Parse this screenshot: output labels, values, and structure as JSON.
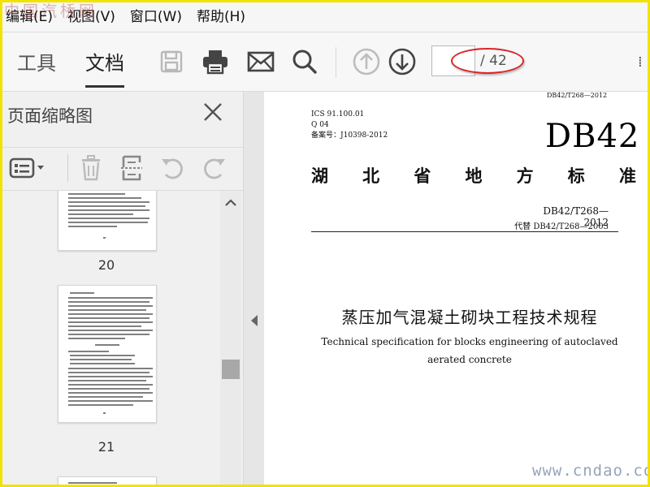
{
  "menubar": {
    "items": [
      "编辑(E)",
      "视图(V)",
      "窗口(W)",
      "帮助(H)"
    ]
  },
  "watermarks": {
    "top": "中国汽桥网",
    "bottom": "www.cndao.com"
  },
  "toolbar": {
    "tabs": [
      "工具",
      "文档"
    ],
    "active_tab": "文档",
    "icons": [
      "save-icon",
      "print-icon",
      "email-icon",
      "search-icon",
      "previous-page-icon",
      "next-page-icon"
    ],
    "page_input": "",
    "page_total": "/ 42",
    "annotation_color": "#d9252a"
  },
  "thumbnail_panel": {
    "title": "页面缩略图",
    "tools": [
      "page-options-icon",
      "delete-page-icon",
      "extract-page-icon",
      "rotate-counterclockwise-icon",
      "rotate-clockwise-icon"
    ],
    "pages": [
      {
        "number": "20"
      },
      {
        "number": "21"
      }
    ]
  },
  "document": {
    "top_code": "DB42/T268—2012",
    "ics": "ICS 91.100.01",
    "q_code": "Q 04",
    "filing": "备案号：J10398-2012",
    "standard_mark": "DB42",
    "province_standard": [
      "湖",
      "北",
      "省",
      "地",
      "方",
      "标",
      "准"
    ],
    "standard_code": "DB42/T268—2012",
    "replaces": "代替 DB42/T268—2003",
    "title_cn": "蒸压加气混凝土砌块工程技术规程",
    "title_en_line1": "Technical specification for blocks engineering of autoclaved",
    "title_en_line2": "aerated concrete"
  }
}
